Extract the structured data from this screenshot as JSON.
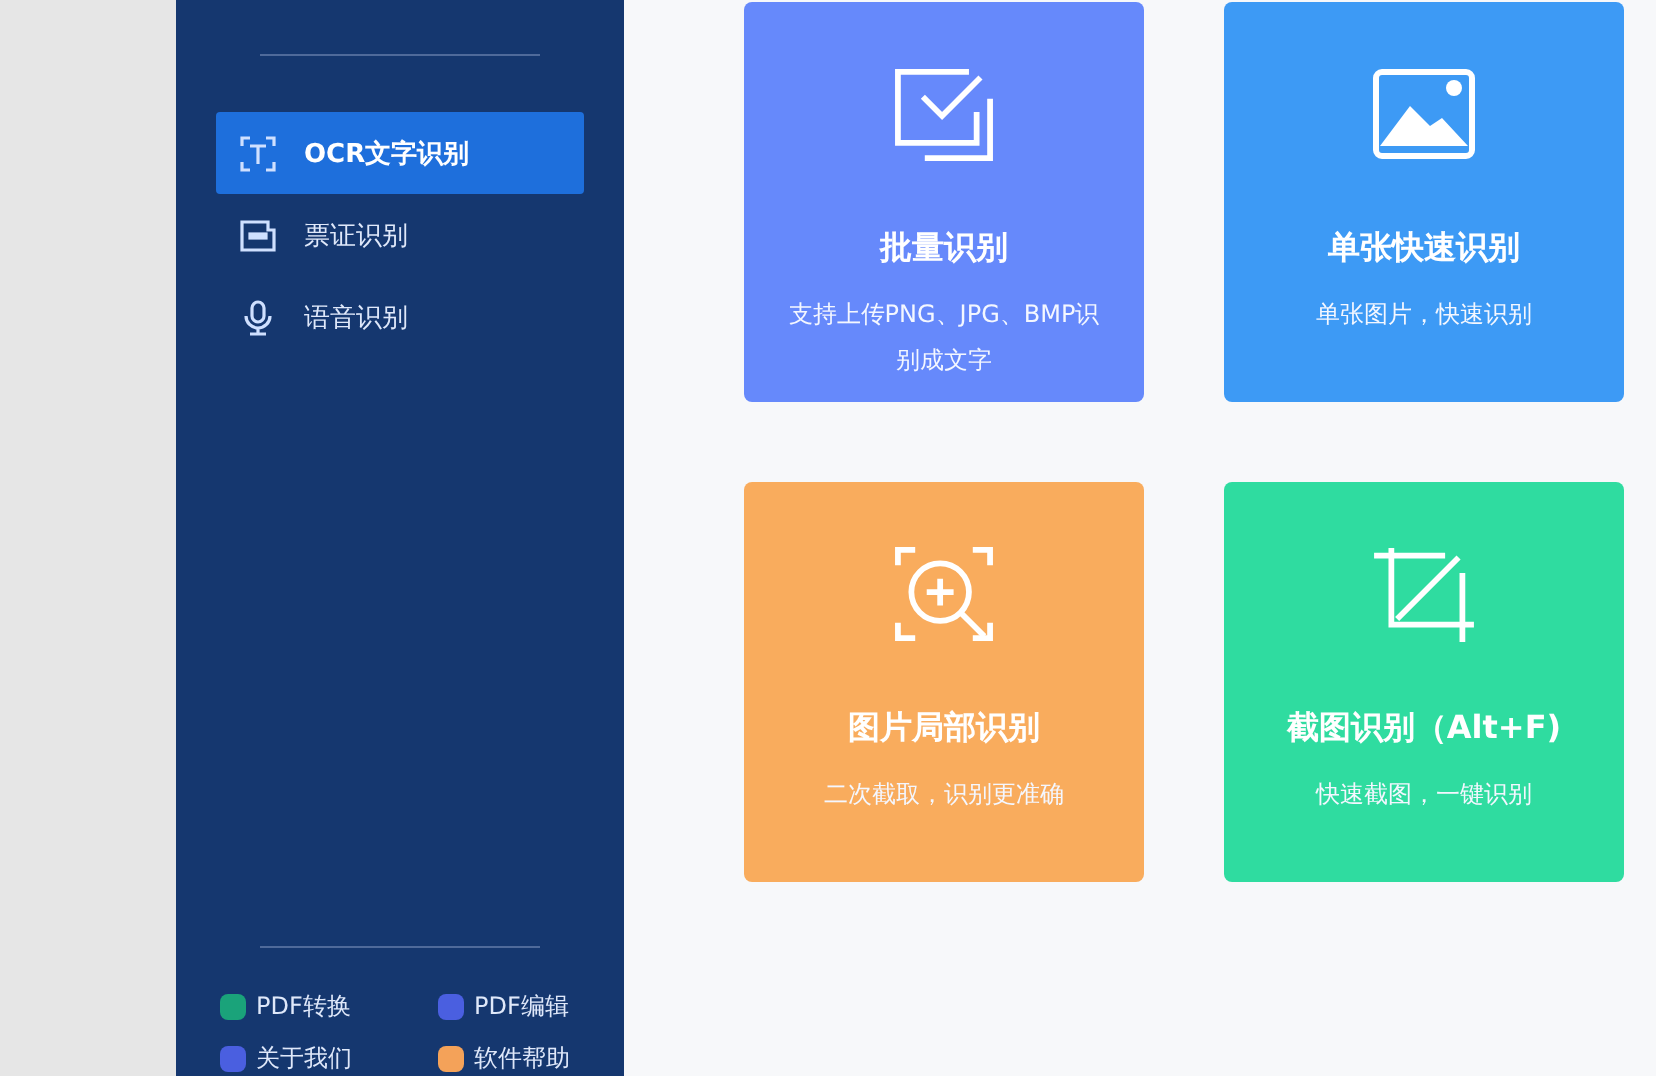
{
  "sidebar": {
    "items": [
      {
        "label": "OCR文字识别",
        "kind": "text",
        "selected": true
      },
      {
        "label": "票证识别",
        "kind": "card",
        "selected": false
      },
      {
        "label": "语音识别",
        "kind": "mic",
        "selected": false
      }
    ],
    "footer_links": [
      {
        "label": "PDF转换",
        "color": "#1aa37a"
      },
      {
        "label": "PDF编辑",
        "color": "#4a5fe0"
      },
      {
        "label": "关于我们",
        "color": "#4a5fe0"
      },
      {
        "label": "软件帮助",
        "color": "#f4a259"
      }
    ]
  },
  "cards": [
    {
      "title": "批量识别",
      "subtitle": "支持上传PNG、JPG、BMP识别成文字",
      "kind": "batch",
      "color": "#6689fb"
    },
    {
      "title": "单张快速识别",
      "subtitle": "单张图片，快速识别",
      "kind": "image",
      "color": "#3d9af5"
    },
    {
      "title": "图片局部识别",
      "subtitle": "二次截取，识别更准确",
      "kind": "zoom",
      "color": "#f9ac5d"
    },
    {
      "title": "截图识别（Alt+F)",
      "subtitle": "快速截图，一键识别",
      "kind": "crop",
      "color": "#2fdca0"
    }
  ]
}
